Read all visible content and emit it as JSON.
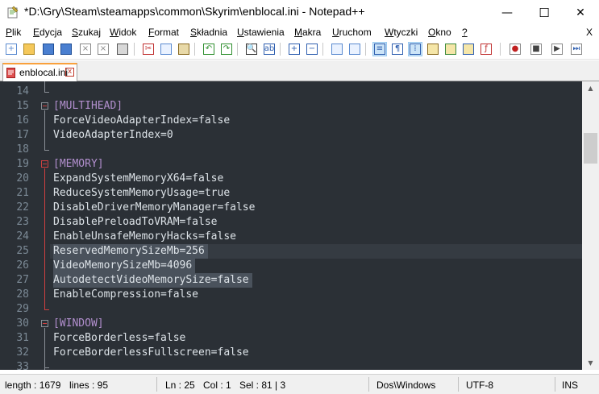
{
  "window": {
    "title": "*D:\\Gry\\Steam\\steamapps\\common\\Skyrim\\enblocal.ini - Notepad++",
    "minimize_glyph": "—",
    "maximize_glyph": "☐",
    "close_glyph": "✕"
  },
  "menu": {
    "items": [
      {
        "label": "Plik",
        "ul": "P",
        "rest": "lik"
      },
      {
        "label": "Edycja",
        "ul": "E",
        "rest": "dycja"
      },
      {
        "label": "Szukaj",
        "ul": "S",
        "rest": "zukaj"
      },
      {
        "label": "Widok",
        "ul": "W",
        "rest": "idok"
      },
      {
        "label": "Format",
        "ul": "F",
        "rest": "ormat"
      },
      {
        "label": "Składnia",
        "ul": "S",
        "rest": "kładnia"
      },
      {
        "label": "Ustawienia",
        "ul": "U",
        "rest": "stawienia"
      },
      {
        "label": "Makra",
        "ul": "M",
        "rest": "akra"
      },
      {
        "label": "Uruchom",
        "ul": "U",
        "rest": "ruchom"
      },
      {
        "label": "Wtyczki",
        "ul": "W",
        "rest": "tyczki"
      },
      {
        "label": "Okno",
        "ul": "O",
        "rest": "kno"
      },
      {
        "label": "?",
        "ul": "?",
        "rest": ""
      }
    ],
    "close_doc": "X"
  },
  "toolbar": {
    "icons": [
      "new-file-icon",
      "open-file-icon",
      "save-icon",
      "save-all-icon",
      "close-icon",
      "close-all-icon",
      "print-icon",
      "cut-icon",
      "copy-icon",
      "paste-icon",
      "undo-icon",
      "redo-icon",
      "find-icon",
      "replace-icon",
      "zoom-in-icon",
      "zoom-out-icon",
      "sync-v-icon",
      "sync-h-icon",
      "word-wrap-icon",
      "show-all-chars-icon",
      "indent-guide-icon",
      "udl-icon",
      "doc-map-icon",
      "function-list-icon",
      "folder-workspace-icon",
      "record-macro-icon",
      "stop-record-icon",
      "play-macro-icon",
      "run-macro-multiple-icon"
    ]
  },
  "tab": {
    "label": "enblocal.ini",
    "close_glyph": "x"
  },
  "editor": {
    "lines": [
      {
        "n": "14",
        "text": "",
        "kind": "plain"
      },
      {
        "n": "15",
        "text": "[MULTIHEAD]",
        "kind": "section"
      },
      {
        "n": "16",
        "text": "ForceVideoAdapterIndex=false",
        "kind": "plain"
      },
      {
        "n": "17",
        "text": "VideoAdapterIndex=0",
        "kind": "plain"
      },
      {
        "n": "18",
        "text": "",
        "kind": "plain"
      },
      {
        "n": "19",
        "text": "[MEMORY]",
        "kind": "section"
      },
      {
        "n": "20",
        "text": "ExpandSystemMemoryX64=false",
        "kind": "plain"
      },
      {
        "n": "21",
        "text": "ReduceSystemMemoryUsage=true",
        "kind": "plain"
      },
      {
        "n": "22",
        "text": "DisableDriverMemoryManager=false",
        "kind": "plain"
      },
      {
        "n": "23",
        "text": "DisablePreloadToVRAM=false",
        "kind": "plain"
      },
      {
        "n": "24",
        "text": "EnableUnsafeMemoryHacks=false",
        "kind": "plain"
      },
      {
        "n": "25",
        "text": "ReservedMemorySizeMb=256",
        "kind": "plain"
      },
      {
        "n": "26",
        "text": "VideoMemorySizeMb=4096",
        "kind": "plain"
      },
      {
        "n": "27",
        "text": "AutodetectVideoMemorySize=false",
        "kind": "plain"
      },
      {
        "n": "28",
        "text": "EnableCompression=false",
        "kind": "plain"
      },
      {
        "n": "29",
        "text": "",
        "kind": "plain"
      },
      {
        "n": "30",
        "text": "[WINDOW]",
        "kind": "section"
      },
      {
        "n": "31",
        "text": "ForceBorderless=false",
        "kind": "plain"
      },
      {
        "n": "32",
        "text": "ForceBorderlessFullscreen=false",
        "kind": "plain"
      },
      {
        "n": "33",
        "text": "",
        "kind": "plain"
      }
    ],
    "current_line": "25"
  },
  "statusbar": {
    "length": "length : 1679",
    "lines": "lines : 95",
    "ln": "Ln : 25",
    "col": "Col : 1",
    "sel": "Sel : 81 | 3",
    "eol": "Dos\\Windows",
    "encoding": "UTF-8",
    "mode": "INS"
  },
  "colors": {
    "editor_bg": "#2b3036",
    "section": "#b28fce",
    "text": "#dde3e8",
    "line_numbers": "#7c8a96",
    "fold_marker": "#d04040",
    "tab_accent": "#f9a13d"
  }
}
